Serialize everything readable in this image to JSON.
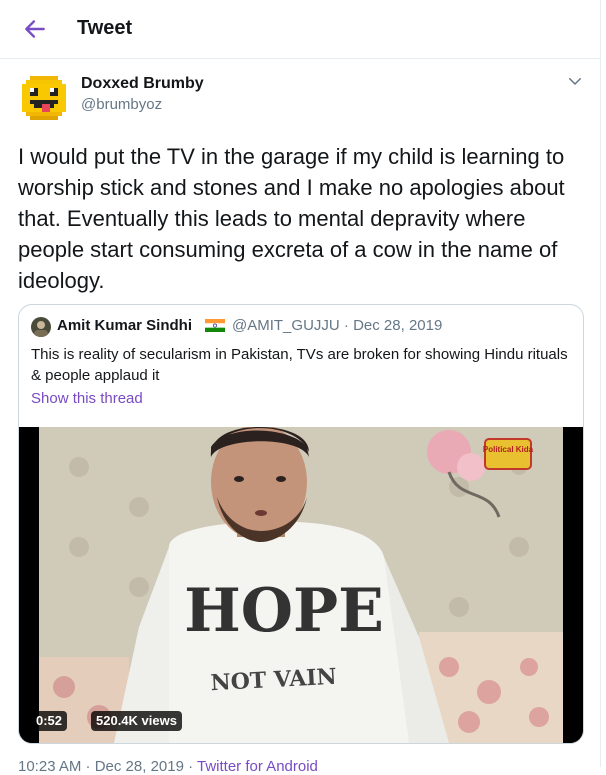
{
  "header": {
    "title": "Tweet"
  },
  "tweet": {
    "author_name": "Doxxed Brumby",
    "author_handle": "@brumbyoz",
    "text": "I would put the TV in the garage if my child is learning to worship stick and stones and I make no apologies about that. Eventually this leads to mental depravity where people start consuming excreta of a cow in the name of ideology."
  },
  "quoted": {
    "author_name": "Amit Kumar Sindhi",
    "author_handle": "@AMIT_GUJJU",
    "separator": " · ",
    "date": "Dec 28, 2019",
    "text": "This is reality of secularism in Pakistan, TVs are broken for showing Hindu rituals & people applaud it",
    "show_thread": "Show this thread",
    "video": {
      "duration": "0:52",
      "views": "520.4K views",
      "shirt_text": "HOPE",
      "shirt_subtext": "NOT VAIN",
      "watermark": "Political Kida"
    }
  },
  "footer": {
    "time": "10:23 AM · Dec 28, 2019 · ",
    "source": "Twitter for Android"
  },
  "colors": {
    "accent": "#794bc4",
    "secondary_text": "#657786",
    "border": "#ccd6dd"
  },
  "icons": {
    "back": "arrow-left-icon",
    "more": "chevron-down-icon",
    "flag": "india-flag-icon"
  }
}
